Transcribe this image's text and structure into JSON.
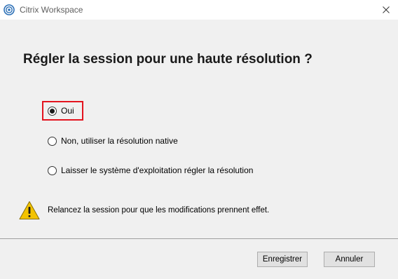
{
  "window": {
    "title": "Citrix Workspace",
    "app_icon": "citrix-logo-icon",
    "close_icon": "close-icon"
  },
  "dialog": {
    "heading": "Régler la session pour une haute résolution ?",
    "options": [
      {
        "label": "Oui",
        "selected": true
      },
      {
        "label": "Non, utiliser la résolution native",
        "selected": false
      },
      {
        "label": "Laisser le système d'exploitation régler la résolution",
        "selected": false
      }
    ],
    "warning": {
      "icon": "warning-icon",
      "text": "Relancez la session pour que les modifications prennent effet."
    }
  },
  "footer": {
    "save_label": "Enregistrer",
    "cancel_label": "Annuler"
  },
  "colors": {
    "highlight_border": "#e3141f",
    "warning_fill": "#f3c300"
  }
}
